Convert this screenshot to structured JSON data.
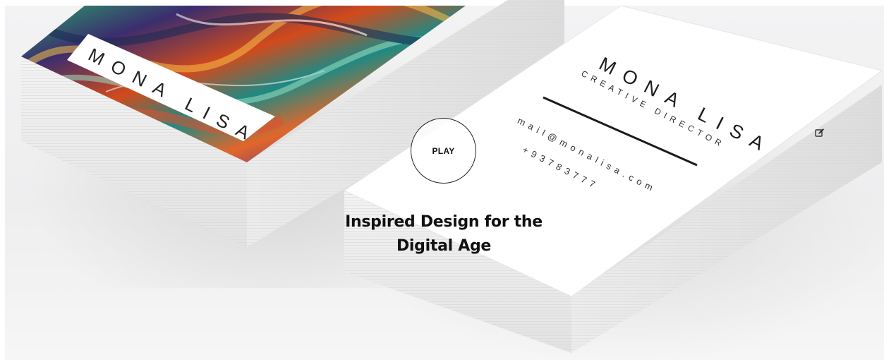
{
  "hero": {
    "play_label": "PLAY",
    "headline_line1": "Inspired Design for the",
    "headline_line2": "Digital Age"
  },
  "left_card": {
    "name": "MONA LISA"
  },
  "right_card": {
    "name": "MONA LISA",
    "role": "CREATIVE DIRECTOR",
    "email": "mail@monalisa.com",
    "phone": "+93783777"
  },
  "icons": {
    "edit": "edit-icon"
  },
  "colors": {
    "background": "#f1f1f2",
    "card_white": "#ffffff",
    "text": "#111111"
  }
}
